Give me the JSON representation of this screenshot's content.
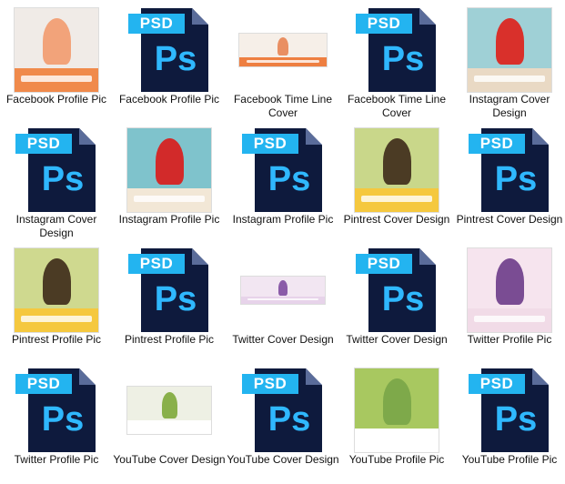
{
  "colors": {
    "psd_tag": "#23b4f0",
    "psd_page": "#0e1a3d",
    "ps_glyph": "#2fb8ff",
    "label_text": "#111111"
  },
  "icons": {
    "psd_file": "photoshop-psd-file-icon"
  },
  "files": [
    {
      "label": "Facebook Profile Pic",
      "kind": "image",
      "style": "fb-profile"
    },
    {
      "label": "Facebook Profile Pic",
      "kind": "psd",
      "tag": "PSD",
      "glyph": "Ps"
    },
    {
      "label": "Facebook Time Line Cover",
      "kind": "image",
      "style": "fb-timeline"
    },
    {
      "label": "Facebook Time Line Cover",
      "kind": "psd",
      "tag": "PSD",
      "glyph": "Ps"
    },
    {
      "label": "Instagram Cover Design",
      "kind": "image",
      "style": "insta-cover"
    },
    {
      "label": "Instagram Cover Design",
      "kind": "psd",
      "tag": "PSD",
      "glyph": "Ps"
    },
    {
      "label": "Instagram Profile Pic",
      "kind": "image",
      "style": "insta-profile"
    },
    {
      "label": "Instagram Profile Pic",
      "kind": "psd",
      "tag": "PSD",
      "glyph": "Ps"
    },
    {
      "label": "Pintrest Cover Design",
      "kind": "image",
      "style": "pin-cover"
    },
    {
      "label": "Pintrest Cover Design",
      "kind": "psd",
      "tag": "PSD",
      "glyph": "Ps"
    },
    {
      "label": "Pintrest Profile Pic",
      "kind": "image",
      "style": "pin-profile"
    },
    {
      "label": "Pintrest Profile Pic",
      "kind": "psd",
      "tag": "PSD",
      "glyph": "Ps"
    },
    {
      "label": "Twitter Cover Design",
      "kind": "image",
      "style": "tw-cover"
    },
    {
      "label": "Twitter Cover Design",
      "kind": "psd",
      "tag": "PSD",
      "glyph": "Ps"
    },
    {
      "label": "Twitter Profile Pic",
      "kind": "image",
      "style": "tw-profile"
    },
    {
      "label": "Twitter Profile Pic",
      "kind": "psd",
      "tag": "PSD",
      "glyph": "Ps"
    },
    {
      "label": "YouTube Cover Design",
      "kind": "image",
      "style": "yt-cover"
    },
    {
      "label": "YouTube Cover Design",
      "kind": "psd",
      "tag": "PSD",
      "glyph": "Ps"
    },
    {
      "label": "YouTube Profile Pic",
      "kind": "image",
      "style": "yt-profile"
    },
    {
      "label": "YouTube Profile Pic",
      "kind": "psd",
      "tag": "PSD",
      "glyph": "Ps"
    }
  ]
}
